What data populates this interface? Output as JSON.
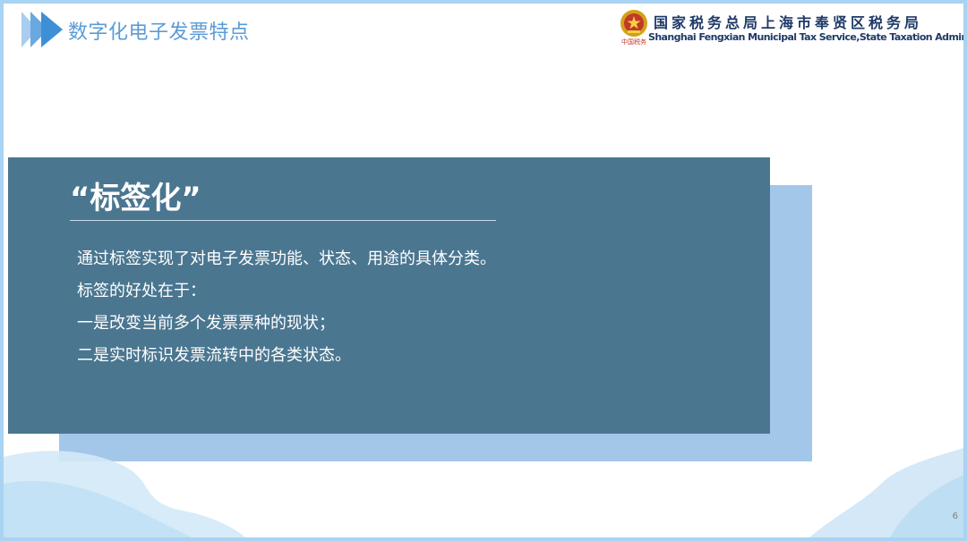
{
  "header": {
    "title": "数字化电子发票特点"
  },
  "organization": {
    "name_cn": "国家税务总局上海市奉贤区税务局",
    "name_en": "Shanghai Fengxian Municipal Tax Service,State Taxation  Administration",
    "emblem_caption": "中国税务"
  },
  "card": {
    "heading": "“标签化”",
    "lines": [
      "通过标签实现了对电子发票功能、状态、用途的具体分类。",
      "标签的好处在于：",
      "一是改变当前多个发票票种的现状；",
      "二是实时标识发票流转中的各类状态。"
    ]
  },
  "page_number": "6",
  "colors": {
    "title_blue": "#5b9bd5",
    "card_bg": "#4a7690",
    "card_shadow": "#a3c7e9",
    "org_navy": "#1f3a68",
    "frame": "#a9d3f2"
  }
}
